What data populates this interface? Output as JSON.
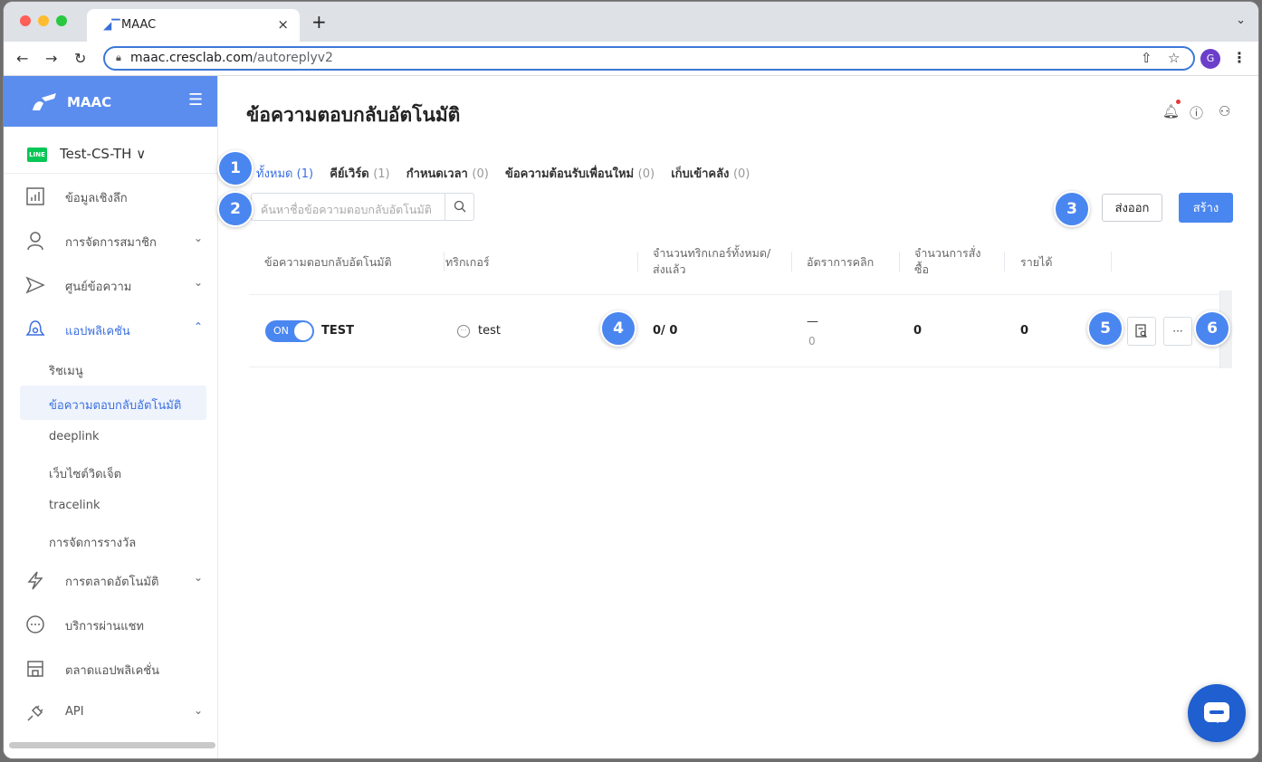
{
  "browser": {
    "tab_title": "MAAC",
    "tab_close": "×",
    "new_tab": "+",
    "url_host": "maac.cresclab.com",
    "url_path": "/autoreplyv2",
    "profile_initial": "G"
  },
  "sidebar": {
    "brand": "MAAC",
    "account_badge": "LINE",
    "account_name": "Test-CS-TH ∨",
    "items": [
      {
        "label": "ข้อมูลเชิงลึก",
        "icon": "bar-chart-icon"
      },
      {
        "label": "การจัดการสมาชิก",
        "icon": "person-icon"
      },
      {
        "label": "ศูนย์ข้อความ",
        "icon": "send-icon"
      },
      {
        "label": "แอปพลิเคชัน",
        "icon": "app-icon"
      },
      {
        "label": "การตลาดอัตโนมัติ",
        "icon": "lightning-icon"
      },
      {
        "label": "บริการผ่านแชท",
        "icon": "chat-icon"
      },
      {
        "label": "ตลาดแอปพลิเคชั่น",
        "icon": "store-icon"
      },
      {
        "label": "API",
        "icon": "plug-icon"
      }
    ],
    "subitems": [
      "ริชเมนู",
      "ข้อความตอบกลับอัตโนมัติ",
      "deeplink",
      "เว็บไซต์วิดเจ็ต",
      "tracelink",
      "การจัดการรางวัล"
    ]
  },
  "main": {
    "title": "ข้อความตอบกลับอัตโนมัติ",
    "tabs": [
      {
        "label": "ทั้งหมด",
        "count": "(1)"
      },
      {
        "label": "คีย์เวิร์ด",
        "count": "(1)"
      },
      {
        "label": "กำหนดเวลา",
        "count": "(0)"
      },
      {
        "label": "ข้อความต้อนรับเพื่อนใหม่",
        "count": "(0)"
      },
      {
        "label": "เก็บเข้าคลัง",
        "count": "(0)"
      }
    ],
    "search_placeholder": "ค้นหาชื่อข้อความตอบกลับอัตโนมัติ",
    "export_label": "ส่งออก",
    "create_label": "สร้าง",
    "columns": [
      "ข้อความตอบกลับอัตโนมัติ",
      "ทริกเกอร์",
      "จำนวนทริกเกอร์ทั้งหมด/",
      "ส่งแล้ว",
      "อัตราการคลิก",
      "จำนวนการสั่ง",
      "ซื้อ",
      "รายได้"
    ],
    "row": {
      "toggle": "ON",
      "name": "TEST",
      "trigger": "test",
      "sent": "0/ 0",
      "ctr": "—",
      "ctr_sub": "0",
      "orders": "0",
      "revenue": "0",
      "more": "···"
    }
  },
  "callouts": [
    "1",
    "2",
    "3",
    "4",
    "5",
    "6"
  ],
  "colors": {
    "accent": "#4a86f0",
    "sidebar_head": "#5b8def",
    "line_green": "#06c755"
  }
}
